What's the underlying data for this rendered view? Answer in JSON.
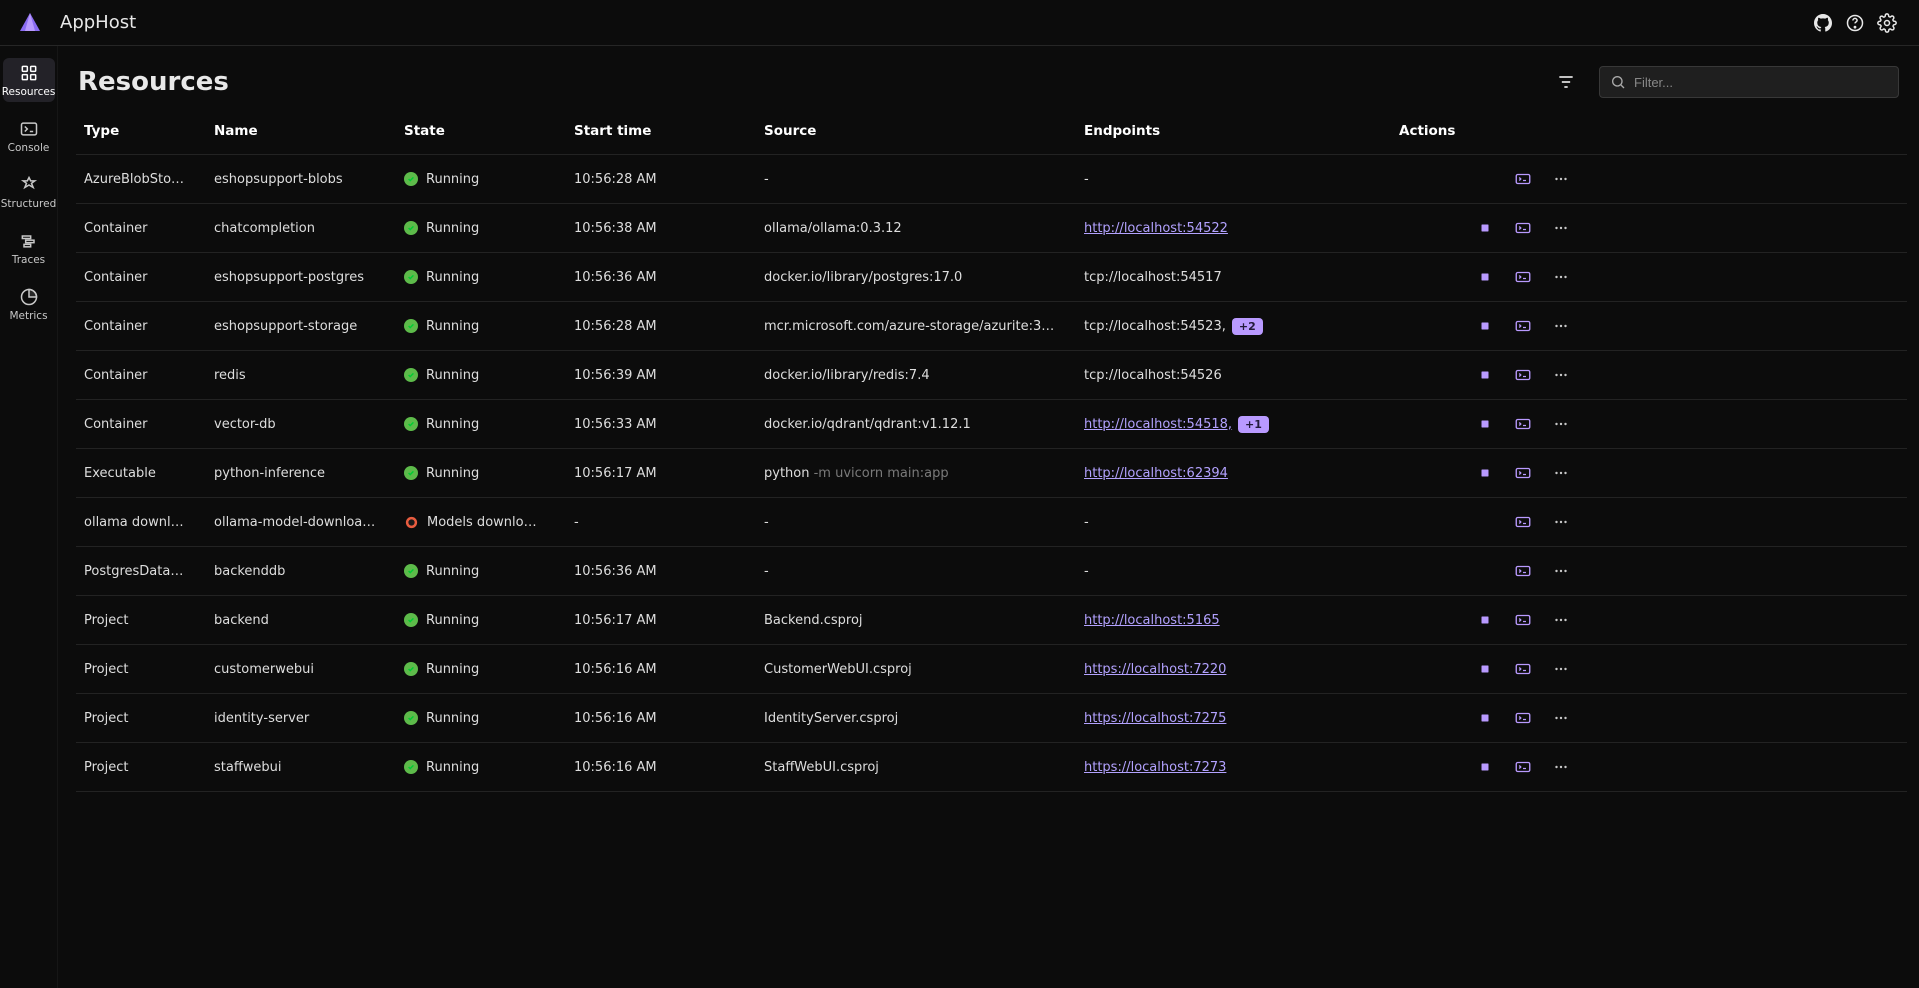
{
  "appTitle": "AppHost",
  "pageTitle": "Resources",
  "search": {
    "placeholder": "Filter..."
  },
  "sidebar": [
    {
      "key": "resources",
      "label": "Resources",
      "active": true
    },
    {
      "key": "console",
      "label": "Console",
      "active": false
    },
    {
      "key": "structured",
      "label": "Structured",
      "active": false
    },
    {
      "key": "traces",
      "label": "Traces",
      "active": false
    },
    {
      "key": "metrics",
      "label": "Metrics",
      "active": false
    }
  ],
  "columns": {
    "type": "Type",
    "name": "Name",
    "state": "State",
    "start": "Start time",
    "source": "Source",
    "endpoints": "Endpoints",
    "actions": "Actions"
  },
  "rows": [
    {
      "type": "AzureBlobSto…",
      "name": "eshopsupport-blobs",
      "state": "Running",
      "stateKind": "ok",
      "start": "10:56:28 AM",
      "source": "-",
      "endpoint": "-",
      "endpointLink": false,
      "badge": null,
      "actionStop": false,
      "actionConsole": true
    },
    {
      "type": "Container",
      "name": "chatcompletion",
      "state": "Running",
      "stateKind": "ok",
      "start": "10:56:38 AM",
      "source": "ollama/ollama:0.3.12",
      "endpoint": "http://localhost:54522",
      "endpointLink": true,
      "badge": null,
      "actionStop": true,
      "actionConsole": true
    },
    {
      "type": "Container",
      "name": "eshopsupport-postgres",
      "state": "Running",
      "stateKind": "ok",
      "start": "10:56:36 AM",
      "source": "docker.io/library/postgres:17.0",
      "endpoint": "tcp://localhost:54517",
      "endpointLink": false,
      "badge": null,
      "actionStop": true,
      "actionConsole": true
    },
    {
      "type": "Container",
      "name": "eshopsupport-storage",
      "state": "Running",
      "stateKind": "ok",
      "start": "10:56:28 AM",
      "source": "mcr.microsoft.com/azure-storage/azurite:3…",
      "endpoint": "tcp://localhost:54523,",
      "endpointLink": false,
      "badge": "+2",
      "actionStop": true,
      "actionConsole": true
    },
    {
      "type": "Container",
      "name": "redis",
      "state": "Running",
      "stateKind": "ok",
      "start": "10:56:39 AM",
      "source": "docker.io/library/redis:7.4",
      "endpoint": "tcp://localhost:54526",
      "endpointLink": false,
      "badge": null,
      "actionStop": true,
      "actionConsole": true
    },
    {
      "type": "Container",
      "name": "vector-db",
      "state": "Running",
      "stateKind": "ok",
      "start": "10:56:33 AM",
      "source": "docker.io/qdrant/qdrant:v1.12.1",
      "endpoint": "http://localhost:54518,",
      "endpointLink": true,
      "badge": "+1",
      "actionStop": true,
      "actionConsole": true
    },
    {
      "type": "Executable",
      "name": "python-inference",
      "state": "Running",
      "stateKind": "ok",
      "start": "10:56:17 AM",
      "source": "python",
      "sourceDim": "-m uvicorn main:app",
      "endpoint": "http://localhost:62394",
      "endpointLink": true,
      "badge": null,
      "actionStop": true,
      "actionConsole": true
    },
    {
      "type": "ollama downl…",
      "name": "ollama-model-downloa…",
      "state": "Models downlo…",
      "stateKind": "warn",
      "start": "-",
      "source": "-",
      "endpoint": "-",
      "endpointLink": false,
      "badge": null,
      "actionStop": false,
      "actionConsole": true
    },
    {
      "type": "PostgresData…",
      "name": "backenddb",
      "state": "Running",
      "stateKind": "ok",
      "start": "10:56:36 AM",
      "source": "-",
      "endpoint": "-",
      "endpointLink": false,
      "badge": null,
      "actionStop": false,
      "actionConsole": true
    },
    {
      "type": "Project",
      "name": "backend",
      "state": "Running",
      "stateKind": "ok",
      "start": "10:56:17 AM",
      "source": "Backend.csproj",
      "endpoint": "http://localhost:5165",
      "endpointLink": true,
      "badge": null,
      "actionStop": true,
      "actionConsole": true
    },
    {
      "type": "Project",
      "name": "customerwebui",
      "state": "Running",
      "stateKind": "ok",
      "start": "10:56:16 AM",
      "source": "CustomerWebUI.csproj",
      "endpoint": "https://localhost:7220",
      "endpointLink": true,
      "badge": null,
      "actionStop": true,
      "actionConsole": true
    },
    {
      "type": "Project",
      "name": "identity-server",
      "state": "Running",
      "stateKind": "ok",
      "start": "10:56:16 AM",
      "source": "IdentityServer.csproj",
      "endpoint": "https://localhost:7275",
      "endpointLink": true,
      "badge": null,
      "actionStop": true,
      "actionConsole": true
    },
    {
      "type": "Project",
      "name": "staffwebui",
      "state": "Running",
      "stateKind": "ok",
      "start": "10:56:16 AM",
      "source": "StaffWebUI.csproj",
      "endpoint": "https://localhost:7273",
      "endpointLink": true,
      "badge": null,
      "actionStop": true,
      "actionConsole": true
    }
  ]
}
